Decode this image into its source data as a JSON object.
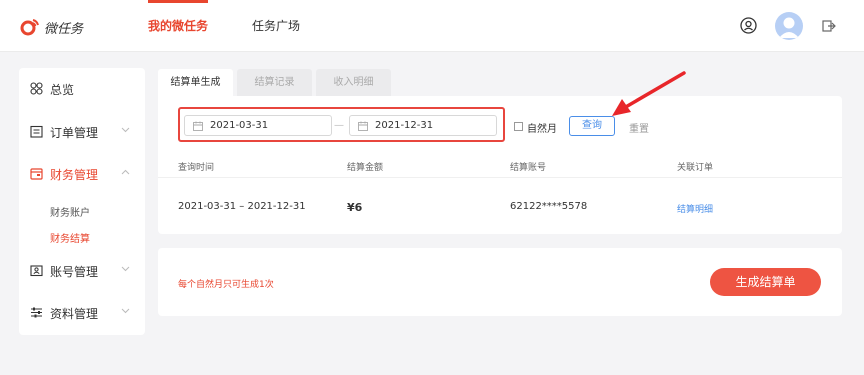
{
  "header": {
    "logo_text": "微任务",
    "nav": [
      {
        "label": "我的微任务",
        "active": true
      },
      {
        "label": "任务广场",
        "active": false
      }
    ],
    "icons": [
      "user-circle-icon",
      "avatar",
      "logout-icon"
    ]
  },
  "sidebar": {
    "items": [
      {
        "label": "总览",
        "icon": "overview-icon"
      },
      {
        "label": "订单管理",
        "icon": "order-icon"
      },
      {
        "label": "财务管理",
        "icon": "wallet-icon",
        "expanded": true
      },
      {
        "label": "账号管理",
        "icon": "account-icon"
      },
      {
        "label": "资料管理",
        "icon": "sliders-icon"
      }
    ],
    "sub_items": [
      {
        "label": "财务账户",
        "active": false
      },
      {
        "label": "财务结算",
        "active": true
      }
    ]
  },
  "tabs": [
    {
      "label": "结算单生成",
      "active": true
    },
    {
      "label": "结算记录",
      "active": false
    },
    {
      "label": "收入明细",
      "active": false
    }
  ],
  "filter": {
    "start_date": "2021-03-31",
    "range_separator": "—",
    "end_date": "2021-12-31",
    "natural_month_label": "自然月",
    "natural_month_checked": false,
    "query_label": "查询",
    "reset_label": "重置"
  },
  "table": {
    "headers": [
      "查询时间",
      "结算金额",
      "结算账号",
      "关联订单"
    ],
    "rows": [
      {
        "time": "2021-03-31 – 2021-12-31",
        "amount": "¥6",
        "account": "62122****5578",
        "link": "结算明细"
      }
    ]
  },
  "footer": {
    "note": "每个自然月只可生成1次",
    "generate_label": "生成结算单"
  },
  "colors": {
    "accent": "#e8462f",
    "link": "#4a8ee8",
    "button_red": "#ee5442",
    "highlight_border": "#e8463e"
  }
}
